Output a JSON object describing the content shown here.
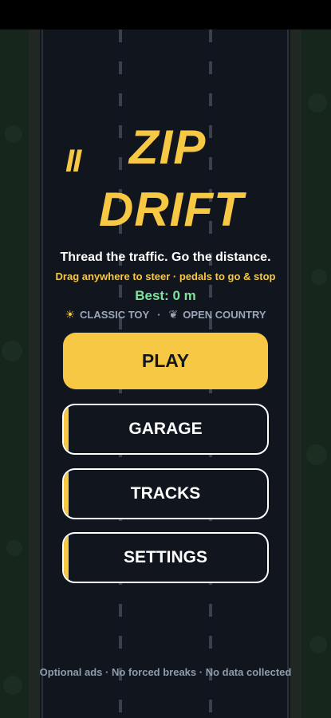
{
  "game": {
    "title_line1": "ZIP",
    "title_line2": "DRIFT",
    "pause_glyph": "II",
    "tagline": "Thread the traffic. Go the distance.",
    "hint": "Drag anywhere to steer · pedals to go & stop",
    "best_label": "Best: 0 m",
    "best_distance_m": 0
  },
  "modes": {
    "car_icon": "sun-icon",
    "car_glyph": "☀",
    "car_label": "CLASSIC TOY",
    "separator": "·",
    "track_icon": "leaf-icon",
    "track_glyph": "❦",
    "track_label": "OPEN COUNTRY"
  },
  "menu": {
    "play": "PLAY",
    "garage": "GARAGE",
    "tracks": "TRACKS",
    "settings": "SETTINGS"
  },
  "footer": "Optional ads · No forced breaks · No data collected",
  "colors": {
    "accent": "#f7c843",
    "road": "#11161e",
    "grass": "#16251c",
    "best": "#7ee29b",
    "muted": "#9aa6b8"
  }
}
